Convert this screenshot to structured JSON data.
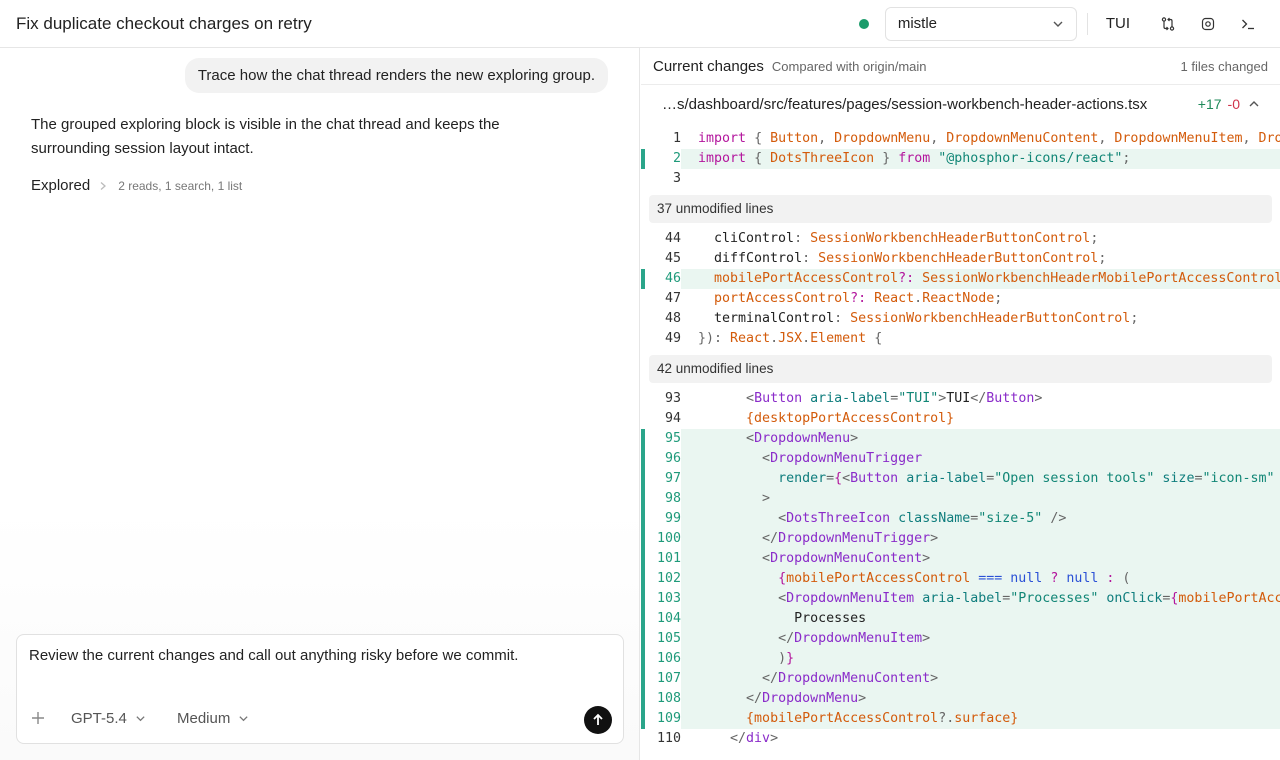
{
  "header": {
    "title": "Fix duplicate checkout charges on retry",
    "branch": "mistle",
    "tui_label": "TUI"
  },
  "thread": {
    "user_message": "Trace how the chat thread renders the new exploring group.",
    "assistant_message": "The grouped exploring block is visible in the chat thread and keeps the surrounding session layout intact.",
    "explored_label": "Explored",
    "explored_meta": "2 reads, 1 search, 1 list"
  },
  "composer": {
    "draft": "Review the current changes and call out anything risky before we commit.",
    "model": "GPT-5.4",
    "effort": "Medium"
  },
  "changes": {
    "title": "Current changes",
    "compared_with": "Compared with origin/main",
    "files_changed": "1 files changed",
    "file_path": "…s/dashboard/src/features/pages/session-workbench-header-actions.tsx",
    "additions": "+17",
    "deletions": "-0",
    "fold_1": "37 unmodified lines",
    "fold_2": "42 unmodified lines"
  },
  "icons": {
    "status": "status-dot-green",
    "chevron": "chevron-down-icon",
    "diff": "git-compare-icon",
    "gear": "gear-icon",
    "terminal": "terminal-icon",
    "plus": "plus-icon",
    "send": "arrow-up-icon"
  },
  "colors": {
    "status_green": "#1a9b6a",
    "added_bg": "#eaf6f1",
    "added_bar": "#2aa58a",
    "additions_text": "#1f8a5a",
    "deletions_text": "#d0344b"
  }
}
